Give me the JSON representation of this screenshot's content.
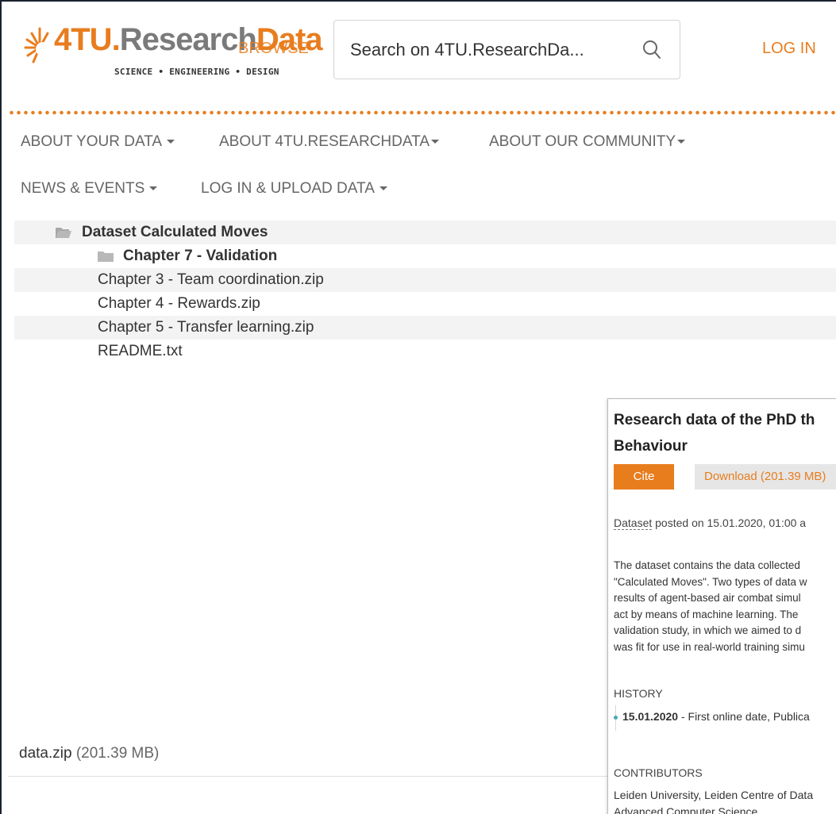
{
  "header": {
    "logo_brand": "4TU.",
    "logo_research": "Research",
    "logo_data": "Data",
    "logo_tagline": "SCIENCE • ENGINEERING • DESIGN",
    "browse_label": "BROWSE",
    "search_placeholder": "Search on 4TU.ResearchDa...",
    "login_label": "LOG IN",
    "accent_color": "#e87d1e"
  },
  "nav": {
    "items": [
      {
        "label": "ABOUT YOUR DATA"
      },
      {
        "label": "ABOUT 4TU.RESEARCHDATA"
      },
      {
        "label": "ABOUT OUR COMMUNITY"
      },
      {
        "label": "NEWS & EVENTS"
      },
      {
        "label": "LOG IN & UPLOAD DATA"
      }
    ]
  },
  "file_tree": {
    "root_folder": "Dataset Calculated Moves",
    "sub_folder": "Chapter 7 - Validation",
    "files": [
      "Chapter 3 - Team coordination.zip",
      "Chapter 4 - Rewards.zip",
      "Chapter 5 - Transfer learning.zip",
      "README.txt"
    ]
  },
  "archive": {
    "name": "data.zip",
    "size": "(201.39 MB)"
  },
  "panel": {
    "title_line1": "Research data of the PhD th",
    "title_line2": "Behaviour",
    "cite_label": "Cite",
    "download_label": "Download (201.39 MB)",
    "posted_link": "Dataset",
    "posted_text": " posted on 15.01.2020, 01:00 a",
    "description_lines": [
      "The dataset contains the data collected",
      "\"Calculated Moves\". Two types of data w",
      "results of agent-based air combat simul",
      "act by means of machine learning. The",
      "validation study, in which we aimed to d",
      "was fit for use in real-world training simu"
    ],
    "history_heading": "HISTORY",
    "history_date": "15.01.2020",
    "history_text": " - First online date, Publica",
    "contributors_heading": "CONTRIBUTORS",
    "contributor_line1": "Leiden University, Leiden Centre of Data",
    "contributor_line2": "Advanced Computer Science"
  }
}
